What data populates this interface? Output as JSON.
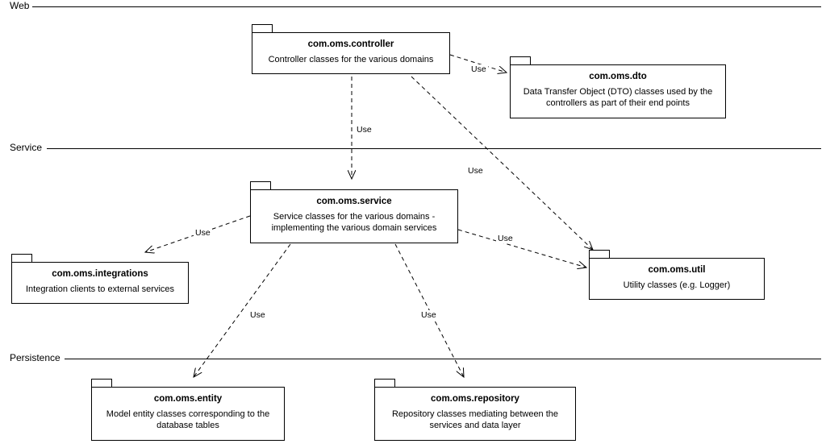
{
  "layers": {
    "web": "Web",
    "service": "Service",
    "persistence": "Persistence"
  },
  "packages": {
    "controller": {
      "name": "com.oms.controller",
      "desc": "Controller classes for the various domains"
    },
    "dto": {
      "name": "com.oms.dto",
      "desc": "Data Transfer Object (DTO) classes used by the controllers as part of their end points"
    },
    "service": {
      "name": "com.oms.service",
      "desc": "Service classes for the various domains - implementing the various domain  services"
    },
    "integrations": {
      "name": "com.oms.integrations",
      "desc": "Integration clients to external services"
    },
    "util": {
      "name": "com.oms.util",
      "desc": "Utility classes (e.g. Logger)"
    },
    "entity": {
      "name": "com.oms.entity",
      "desc": "Model entity classes corresponding to the database tables"
    },
    "repository": {
      "name": "com.oms.repository",
      "desc": "Repository classes mediating between the services and data layer"
    }
  },
  "edgeLabel": "Use",
  "dependencies": [
    {
      "from": "controller",
      "to": "dto"
    },
    {
      "from": "controller",
      "to": "service"
    },
    {
      "from": "controller",
      "to": "util"
    },
    {
      "from": "service",
      "to": "integrations"
    },
    {
      "from": "service",
      "to": "util"
    },
    {
      "from": "service",
      "to": "entity"
    },
    {
      "from": "service",
      "to": "repository"
    }
  ]
}
